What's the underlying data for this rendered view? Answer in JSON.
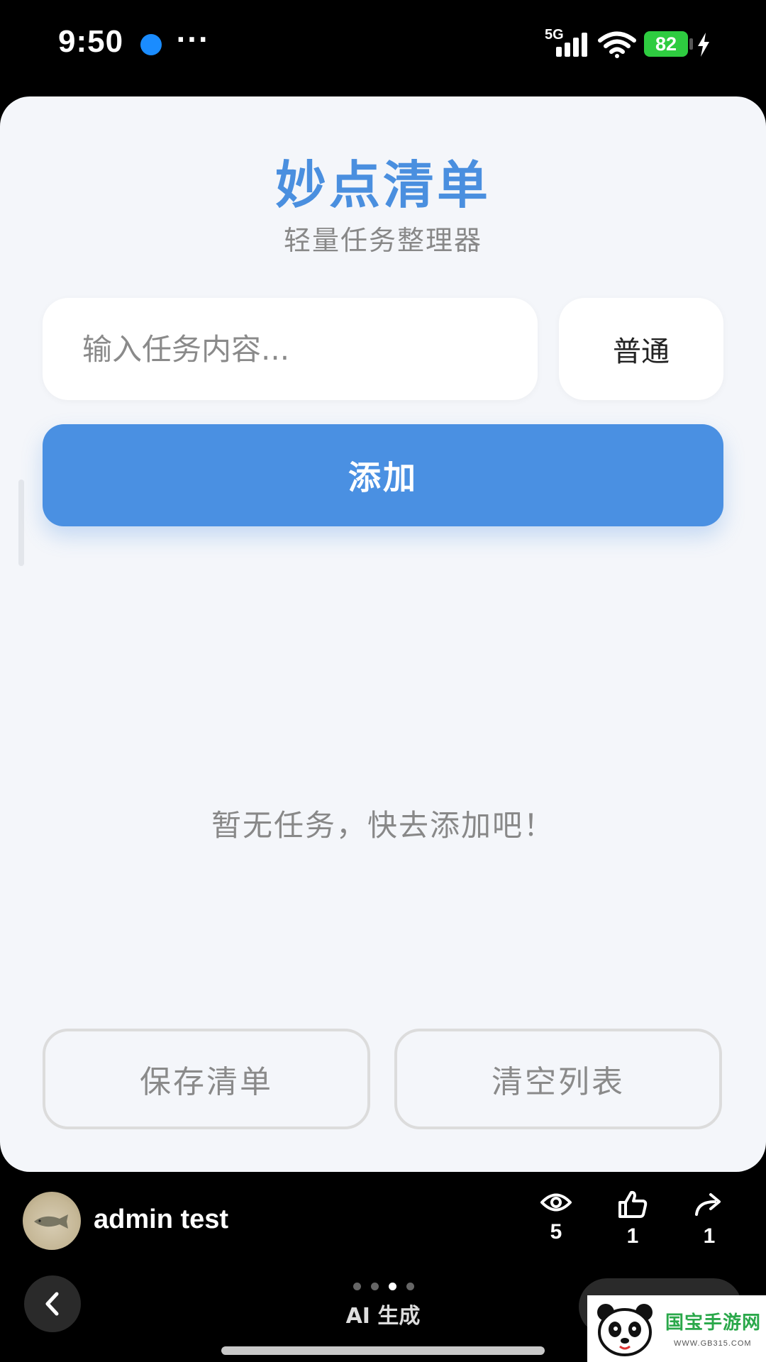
{
  "status_bar": {
    "time": "9:50",
    "more": "···",
    "network": "5G",
    "battery": "82"
  },
  "app": {
    "title": "妙点清单",
    "subtitle": "轻量任务整理器",
    "task_input_placeholder": "输入任务内容...",
    "priority_value": "普通",
    "add_button": "添加",
    "empty_message": "暂无任务，快去添加吧！",
    "save_button": "保存清单",
    "clear_button": "清空列表"
  },
  "author": {
    "name": "admin test",
    "views": "5",
    "likes": "1",
    "shares": "1"
  },
  "bottom": {
    "label": "AI 生成",
    "page_count": 4,
    "active_page": 3
  },
  "watermark": {
    "text": "国宝手游网",
    "url": "WWW.GB315.COM"
  },
  "colors": {
    "accent": "#4a90e2",
    "title": "#4a8fdf",
    "card_background": "#f4f6fa",
    "battery": "#2ecc40"
  }
}
